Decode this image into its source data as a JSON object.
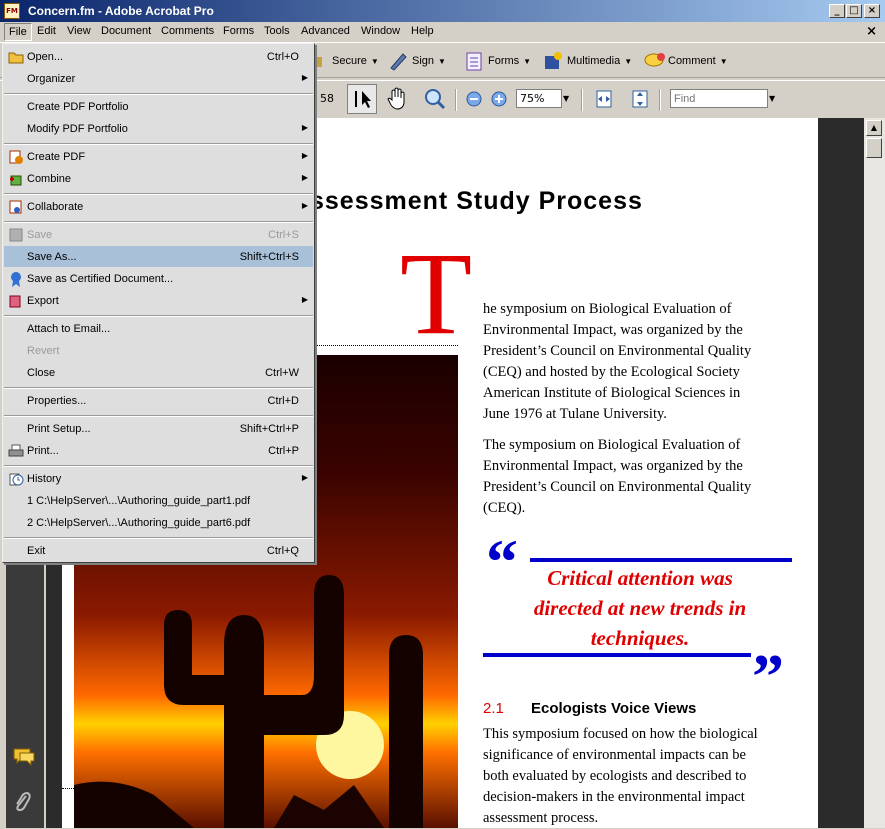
{
  "window": {
    "title": "Concern.fm  - Adobe Acrobat Pro"
  },
  "menubar": [
    "File",
    "Edit",
    "View",
    "Document",
    "Comments",
    "Forms",
    "Tools",
    "Advanced",
    "Window",
    "Help"
  ],
  "toolbar1": {
    "secure": "Secure",
    "sign": "Sign",
    "forms": "Forms",
    "multimedia": "Multimedia",
    "comment": "Comment"
  },
  "toolbar2": {
    "page_fragment": "58",
    "zoom": "75%",
    "find_placeholder": "Find"
  },
  "file_menu": {
    "items": [
      {
        "label": "Open...",
        "shortcut": "Ctrl+O",
        "icon": "folder-open-icon"
      },
      {
        "label": "Organizer",
        "submenu": true
      },
      {
        "label": "Create PDF Portfolio"
      },
      {
        "label": "Modify PDF Portfolio",
        "submenu": true
      },
      {
        "label": "Create PDF",
        "submenu": true,
        "icon": "create-pdf-icon"
      },
      {
        "label": "Combine",
        "submenu": true,
        "icon": "combine-icon"
      },
      {
        "label": "Collaborate",
        "submenu": true,
        "icon": "collaborate-icon"
      },
      {
        "label": "Save",
        "shortcut": "Ctrl+S",
        "disabled": true,
        "icon": "save-icon"
      },
      {
        "label": "Save As...",
        "shortcut": "Shift+Ctrl+S",
        "highlighted": true
      },
      {
        "label": "Save as Certified Document...",
        "icon": "certified-ribbon-icon"
      },
      {
        "label": "Export",
        "submenu": true,
        "icon": "export-icon"
      },
      {
        "label": "Attach to Email..."
      },
      {
        "label": "Revert",
        "disabled": true
      },
      {
        "label": "Close",
        "shortcut": "Ctrl+W"
      },
      {
        "label": "Properties...",
        "shortcut": "Ctrl+D"
      },
      {
        "label": "Print Setup...",
        "shortcut": "Shift+Ctrl+P"
      },
      {
        "label": "Print...",
        "shortcut": "Ctrl+P",
        "icon": "printer-icon"
      },
      {
        "label": "History",
        "submenu": true,
        "icon": "history-clock-icon"
      },
      {
        "label": "1 C:\\HelpServer\\...\\Authoring_guide_part1.pdf"
      },
      {
        "label": "2 C:\\HelpServer\\...\\Authoring_guide_part6.pdf"
      },
      {
        "label": "Exit",
        "shortcut": "Ctrl+Q"
      }
    ]
  },
  "document": {
    "heading": "ssessment Study Process",
    "dropcap": "T",
    "para1": "he symposium on Biological Evaluation of\nEnvironmental Impact, was organized by the\nPresident’s Council on Environmental Quality\n(CEQ) and hosted by the Ecological Society\nAmerican Institute of Biological Sciences in\nJune 1976 at Tulane University.",
    "para2": "The symposium on Biological Evaluation of\nEnvironmental Impact, was organized by the\nPresident’s Council on Environmental Quality\n(CEQ).",
    "pullquote": "Critical attention was\ndirected at new trends in\ntechniques.",
    "open_quote": "“",
    "close_quote": "”",
    "section_number": "2.1",
    "section_title": "Ecologists Voice Views",
    "para3": "This symposium focused on how the biological\nsignificance of environmental impacts can be\nboth evaluated by ecologists and described to\ndecision-makers in the environmental impact\nassessment process."
  },
  "colors": {
    "accent_red": "#e00000",
    "quote_blue": "#0000cc",
    "menu_highlight": "#a8c0d8"
  }
}
